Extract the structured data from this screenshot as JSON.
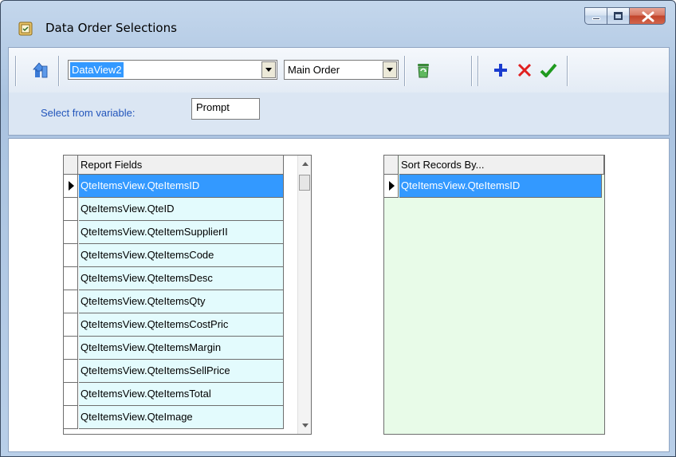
{
  "window": {
    "title": "Data Order Selections"
  },
  "toolbar": {
    "dataview_value": "DataView2",
    "order_value": "Main Order"
  },
  "variable": {
    "label": "Select from variable:",
    "value": "Prompt"
  },
  "report_fields": {
    "header": "Report Fields",
    "rows": [
      "QteItemsView.QteItemsID",
      "QteItemsView.QteID",
      "QteItemsView.QteItemSupplierII",
      "QteItemsView.QteItemsCode",
      "QteItemsView.QteItemsDesc",
      "QteItemsView.QteItemsQty",
      "QteItemsView.QteItemsCostPric",
      "QteItemsView.QteItemsMargin",
      "QteItemsView.QteItemsSellPrice",
      "QteItemsView.QteItemsTotal",
      "QteItemsView.QteImage"
    ]
  },
  "sort_records": {
    "header": "Sort Records By...",
    "rows": [
      "QteItemsView.QteItemsID"
    ]
  },
  "colors": {
    "accent": "#3399ff",
    "field_row_bg": "#e3fbfd",
    "sort_panel_bg": "#e8fbe8",
    "label_blue": "#2255bb",
    "add_icon": "#1a3ccf",
    "delete_icon": "#e02020",
    "ok_icon": "#1f9a1f"
  }
}
